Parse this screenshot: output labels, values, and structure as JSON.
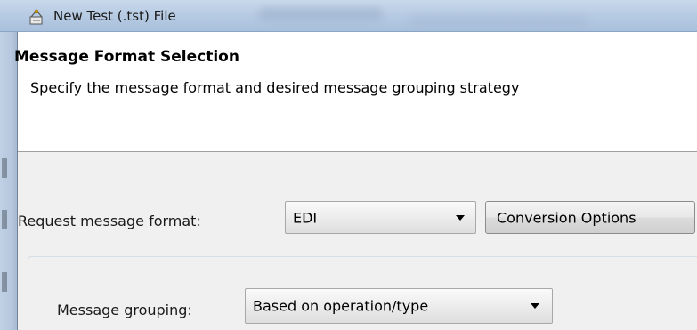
{
  "window": {
    "title": "New Test (.tst) File",
    "icon": "wizard-icon"
  },
  "banner": {
    "title": "Message Format Selection",
    "description": "Specify the message format and desired message grouping strategy"
  },
  "format": {
    "label": "Request message format:",
    "selected": "EDI",
    "conversion_button": "Conversion Options"
  },
  "grouping": {
    "label": "Message grouping:",
    "selected": "Based on operation/type"
  }
}
